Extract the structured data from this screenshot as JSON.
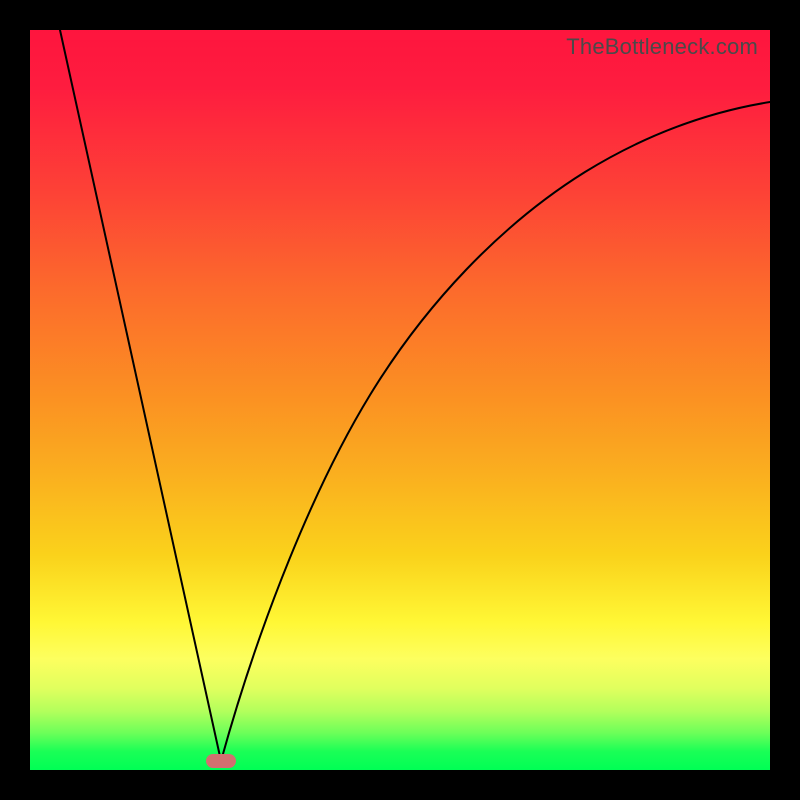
{
  "watermark": "TheBottleneck.com",
  "chart_data": {
    "type": "line",
    "title": "",
    "xlabel": "",
    "ylabel": "",
    "xlim": [
      0,
      1
    ],
    "ylim": [
      0,
      1
    ],
    "series": [
      {
        "name": "left-branch",
        "x": [
          0.04,
          0.258
        ],
        "y": [
          1.0,
          0.012
        ]
      },
      {
        "name": "right-branch",
        "x": [
          0.258,
          0.3,
          0.35,
          0.4,
          0.45,
          0.5,
          0.55,
          0.6,
          0.65,
          0.7,
          0.75,
          0.8,
          0.85,
          0.9,
          0.95,
          1.0
        ],
        "y": [
          0.012,
          0.155,
          0.3,
          0.415,
          0.51,
          0.59,
          0.655,
          0.708,
          0.752,
          0.788,
          0.818,
          0.842,
          0.862,
          0.878,
          0.891,
          0.902
        ]
      }
    ],
    "marker": {
      "x": 0.258,
      "y": 0.012,
      "color": "#d17070"
    },
    "background_gradient": {
      "stops": [
        {
          "pos": 0.0,
          "color": "#fe153e"
        },
        {
          "pos": 0.5,
          "color": "#fb9222"
        },
        {
          "pos": 0.8,
          "color": "#fff735"
        },
        {
          "pos": 1.0,
          "color": "#00ff55"
        }
      ]
    }
  }
}
